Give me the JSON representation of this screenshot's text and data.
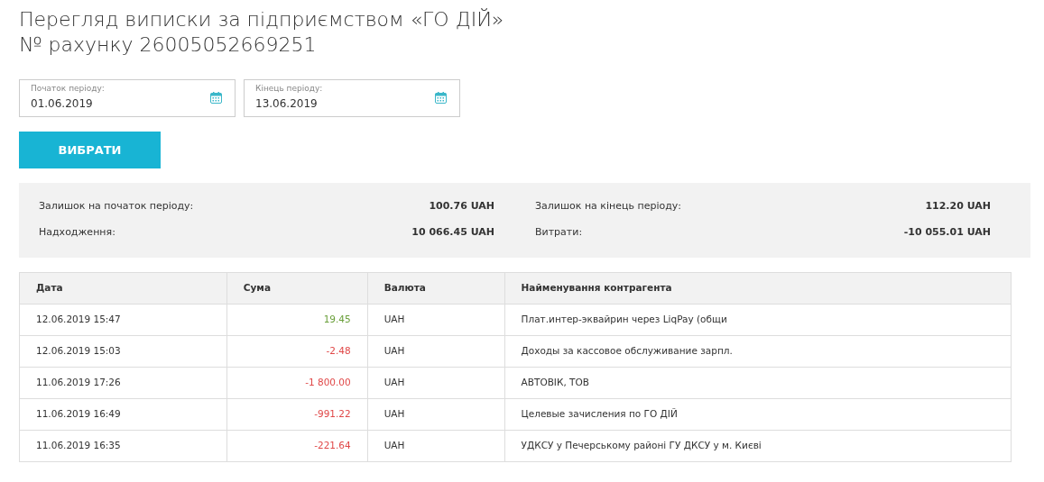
{
  "title_lines": [
    "Перегляд виписки за підприємством «ГО ДІЙ»",
    "№ рахунку 26005052669251"
  ],
  "date_fields": [
    {
      "label": "Початок періоду:",
      "value": "01.06.2019"
    },
    {
      "label": "Кінець періоду:",
      "value": "13.06.2019"
    }
  ],
  "select_button": "ВИБРАТИ",
  "summary": [
    {
      "label": "Залишок на початок періоду:",
      "value": "100.76 UAH"
    },
    {
      "label": "Залишок на кінець періоду:",
      "value": "112.20 UAH"
    },
    {
      "label": "Надходження:",
      "value": "10 066.45 UAH"
    },
    {
      "label": "Витрати:",
      "value": "-10 055.01 UAH"
    }
  ],
  "table": {
    "columns": [
      "Дата",
      "Сума",
      "Валюта",
      "Найменування контрагента"
    ],
    "rows": [
      {
        "date": "12.06.2019 15:47",
        "amount": "19.45",
        "kind": "credit",
        "currency": "UAH",
        "counterparty": "Плат.интер-эквайрин через LiqPay (общи"
      },
      {
        "date": "12.06.2019 15:03",
        "amount": "-2.48",
        "kind": "debit",
        "currency": "UAH",
        "counterparty": "Доходы за кассовое обслуживание зарпл."
      },
      {
        "date": "11.06.2019 17:26",
        "amount": "-1 800.00",
        "kind": "debit",
        "currency": "UAH",
        "counterparty": "АВТОВІК, ТОВ"
      },
      {
        "date": "11.06.2019 16:49",
        "amount": "-991.22",
        "kind": "debit",
        "currency": "UAH",
        "counterparty": "Целевые зачисления по ГО ДІЙ"
      },
      {
        "date": "11.06.2019 16:35",
        "amount": "-221.64",
        "kind": "debit",
        "currency": "UAH",
        "counterparty": "УДКСУ у Печерському районі ГУ ДКСУ у м. Києві"
      }
    ]
  }
}
